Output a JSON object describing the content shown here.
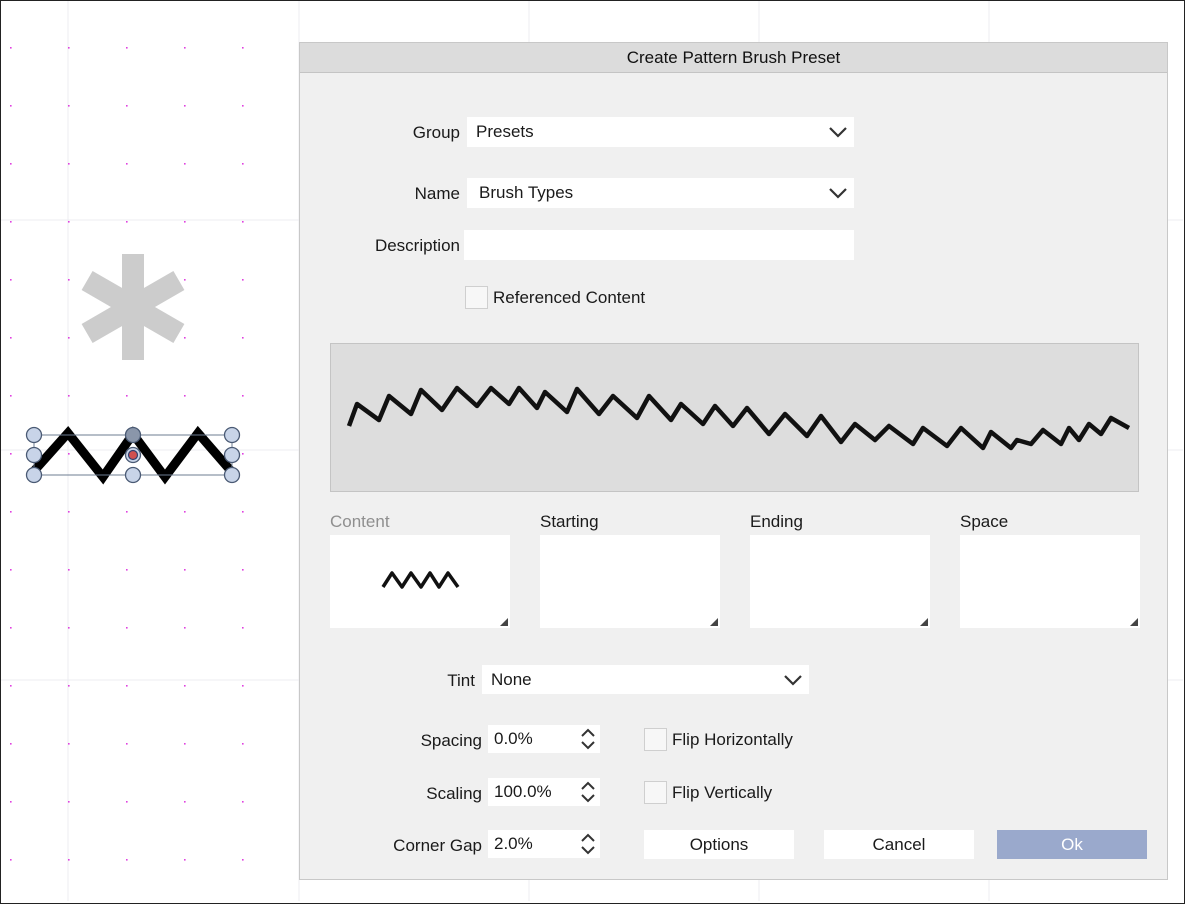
{
  "dialog": {
    "title": "Create Pattern Brush Preset",
    "group_label": "Group",
    "group_value": "Presets",
    "name_label": "Name",
    "name_value": "Brush Types",
    "description_label": "Description",
    "description_value": "",
    "referenced_content_label": "Referenced Content",
    "referenced_content_checked": false,
    "slots": [
      {
        "label": "Content",
        "disabled": true
      },
      {
        "label": "Starting",
        "disabled": false
      },
      {
        "label": "Ending",
        "disabled": false
      },
      {
        "label": "Space",
        "disabled": false
      }
    ],
    "tint_label": "Tint",
    "tint_value": "None",
    "spacing_label": "Spacing",
    "spacing_value": "0.0%",
    "scaling_label": "Scaling",
    "scaling_value": "100.0%",
    "corner_gap_label": "Corner Gap",
    "corner_gap_value": "2.0%",
    "flip_h_label": "Flip Horizontally",
    "flip_h_checked": false,
    "flip_v_label": "Flip Vertically",
    "flip_v_checked": false,
    "options_label": "Options",
    "cancel_label": "Cancel",
    "ok_label": "Ok"
  },
  "colors": {
    "primary_button": "#9aa9cc",
    "dialog_bg": "#f0f0f0",
    "grid_dot": "#e040e0",
    "selection_handle": "#c8d4e8"
  }
}
